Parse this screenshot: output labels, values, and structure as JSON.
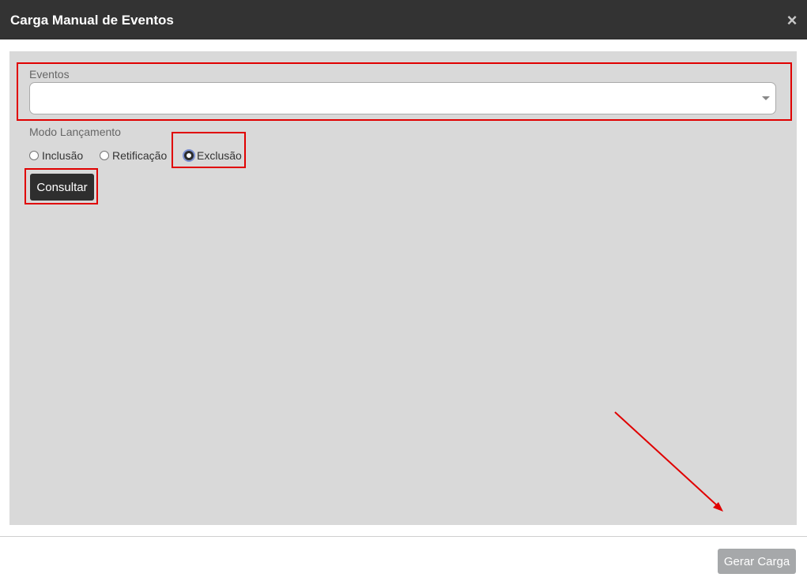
{
  "modal": {
    "title": "Carga Manual de Eventos",
    "close_glyph": "×"
  },
  "form": {
    "eventos_label": "Eventos",
    "eventos_value": "",
    "modo_label": "Modo Lançamento",
    "radio_options": [
      {
        "label": "Inclusão",
        "checked": false
      },
      {
        "label": "Retificação",
        "checked": false
      },
      {
        "label": "Exclusão",
        "checked": true
      }
    ],
    "consultar_label": "Consultar"
  },
  "footer": {
    "gerar_label": "Gerar Carga"
  },
  "colors": {
    "header_bg": "#333333",
    "body_bg": "#d9d9d9",
    "highlight": "#e00000",
    "disabled_button": "#a6a8aa"
  },
  "icons": {
    "close": "close-icon",
    "dropdown": "chevron-down-icon",
    "annotation": "arrow-annotation"
  }
}
